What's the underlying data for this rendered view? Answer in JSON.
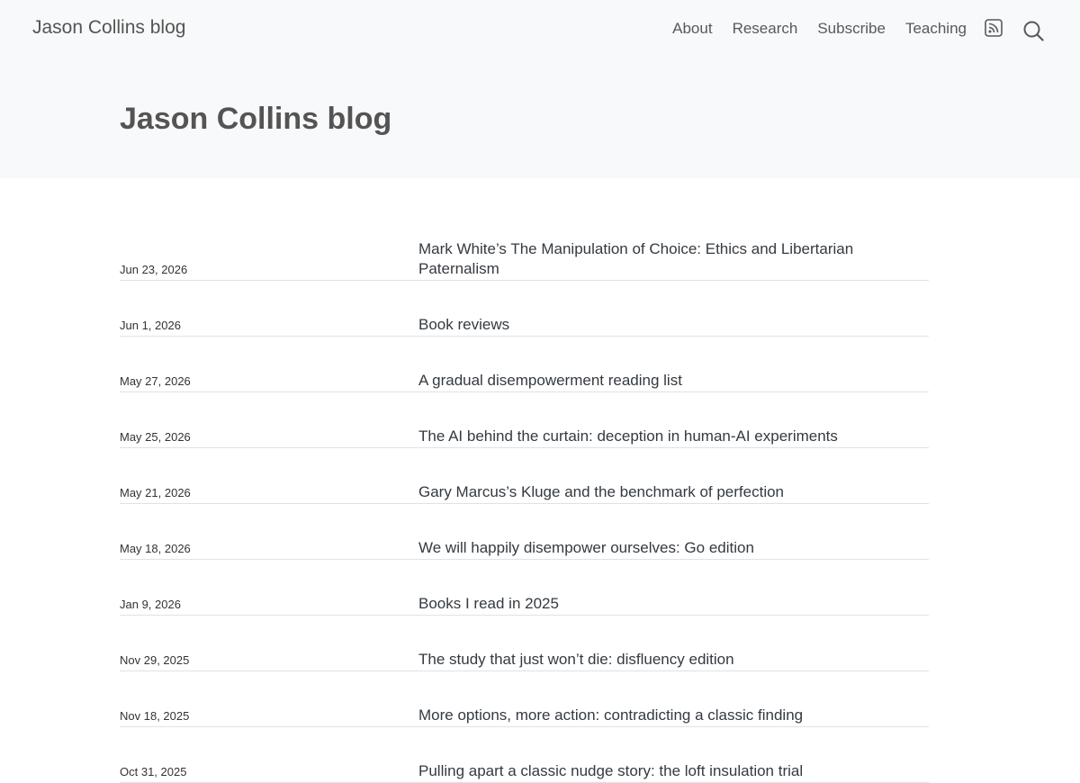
{
  "header": {
    "brand": "Jason Collins blog",
    "nav": [
      {
        "label": "About"
      },
      {
        "label": "Research"
      },
      {
        "label": "Subscribe"
      },
      {
        "label": "Teaching"
      }
    ],
    "icons": [
      "rss-icon",
      "search-icon"
    ]
  },
  "page": {
    "title": "Jason Collins blog"
  },
  "posts": [
    {
      "date": "Jun 23, 2026",
      "title": "Mark White’s The Manipulation of Choice: Ethics and Libertarian Paternalism"
    },
    {
      "date": "Jun 1, 2026",
      "title": "Book reviews"
    },
    {
      "date": "May 27, 2026",
      "title": "A gradual disempowerment reading list"
    },
    {
      "date": "May 25, 2026",
      "title": "The AI behind the curtain: deception in human-AI experiments"
    },
    {
      "date": "May 21, 2026",
      "title": "Gary Marcus’s Kluge and the benchmark of perfection"
    },
    {
      "date": "May 18, 2026",
      "title": "We will happily disempower ourselves: Go edition"
    },
    {
      "date": "Jan 9, 2026",
      "title": "Books I read in 2025"
    },
    {
      "date": "Nov 29, 2025",
      "title": "The study that just won’t die: disfluency edition"
    },
    {
      "date": "Nov 18, 2025",
      "title": "More options, more action: contradicting a classic finding"
    },
    {
      "date": "Oct 31, 2025",
      "title": "Pulling apart a classic nudge story: the loft insulation trial"
    }
  ],
  "colors": {
    "banner_bg": "#f8f9fa",
    "text_muted": "#545454",
    "divider": "#dee2e6"
  }
}
